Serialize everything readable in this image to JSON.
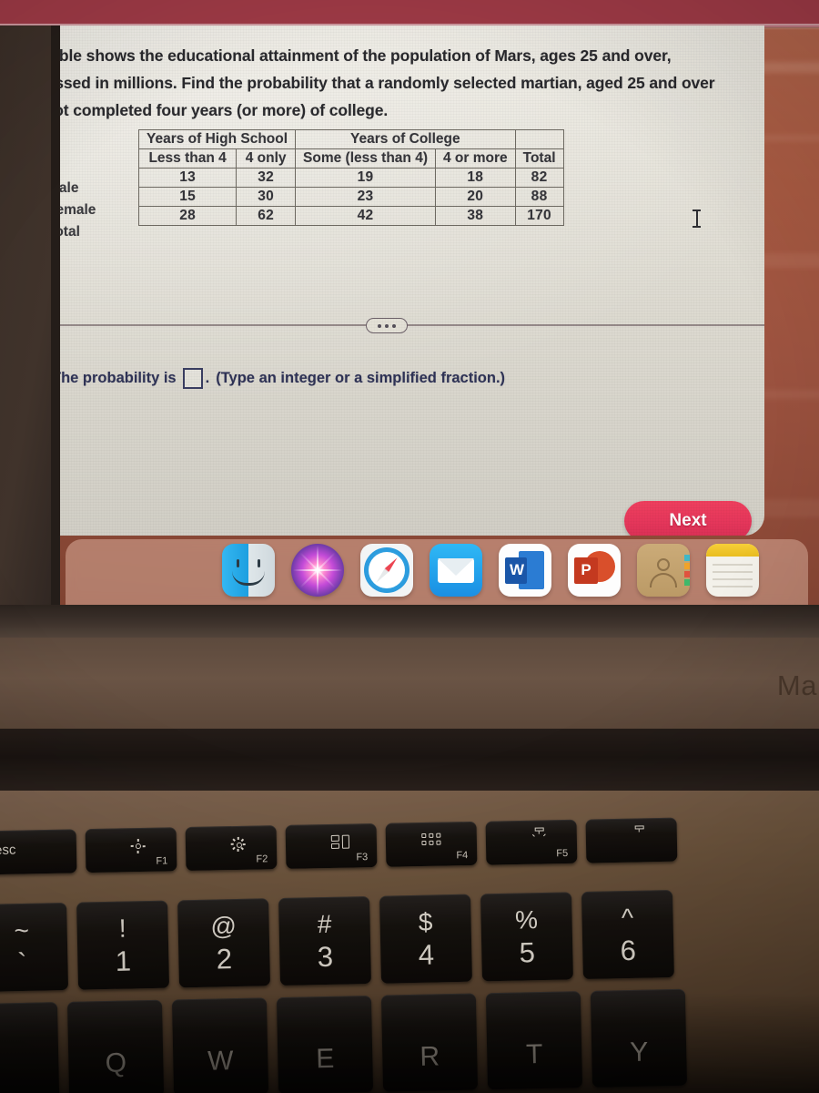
{
  "problem": {
    "lines": [
      "The table shows the educational attainment of the population of Mars, ages 25 and over,",
      "expressed in millions. Find the probability that a randomly selected martian, aged 25 and over",
      "has not completed four years (or more) of college."
    ]
  },
  "table": {
    "group_headers": [
      {
        "label": "Years of High School",
        "colspan": 2
      },
      {
        "label": "Years of College",
        "colspan": 2
      },
      {
        "label": "",
        "colspan": 1
      }
    ],
    "columns": [
      "Less than 4",
      "4 only",
      "Some (less than 4)",
      "4 or more",
      "Total"
    ],
    "rows": [
      {
        "label": "Male",
        "values": [
          "13",
          "32",
          "19",
          "18",
          "82"
        ]
      },
      {
        "label": "Female",
        "values": [
          "15",
          "30",
          "23",
          "20",
          "88"
        ]
      },
      {
        "label": "Total",
        "values": [
          "28",
          "62",
          "42",
          "38",
          "170"
        ]
      }
    ]
  },
  "answer": {
    "prefix": "The probability is",
    "value": "",
    "period": ".",
    "hint": "(Type an integer or a simplified fraction.)"
  },
  "buttons": {
    "next_label": "Next",
    "ellipsis_label": "more-options"
  },
  "dock": {
    "items": [
      {
        "name": "finder",
        "label": "Finder"
      },
      {
        "name": "siri",
        "label": "Siri"
      },
      {
        "name": "safari",
        "label": "Safari"
      },
      {
        "name": "mail",
        "label": "Mail"
      },
      {
        "name": "word",
        "label": "Microsoft Word",
        "glyph": "W"
      },
      {
        "name": "powerpoint",
        "label": "Microsoft PowerPoint",
        "glyph": "P"
      },
      {
        "name": "contacts",
        "label": "Contacts"
      },
      {
        "name": "notes",
        "label": "Notes"
      }
    ]
  },
  "laptop": {
    "brand_text": "Ma",
    "function_row": [
      {
        "key": "esc",
        "label": "esc",
        "icon": ""
      },
      {
        "key": "F1",
        "label": "F1",
        "icon": "brightness-down-icon"
      },
      {
        "key": "F2",
        "label": "F2",
        "icon": "brightness-up-icon"
      },
      {
        "key": "F3",
        "label": "F3",
        "icon": "mission-control-icon"
      },
      {
        "key": "F4",
        "label": "F4",
        "icon": "launchpad-icon"
      },
      {
        "key": "F5",
        "label": "F5",
        "icon": "keyboard-backlight-icon"
      },
      {
        "key": "F6",
        "label": "",
        "icon": "keyboard-backlight-up-icon"
      }
    ],
    "number_row": [
      {
        "upper": "~",
        "lower": "`"
      },
      {
        "upper": "!",
        "lower": "1"
      },
      {
        "upper": "@",
        "lower": "2"
      },
      {
        "upper": "#",
        "lower": "3"
      },
      {
        "upper": "$",
        "lower": "4"
      },
      {
        "upper": "%",
        "lower": "5"
      },
      {
        "upper": "^",
        "lower": "6"
      }
    ],
    "letter_row": [
      "Q",
      "W",
      "E",
      "R",
      "T",
      "Y"
    ]
  },
  "colors": {
    "accent_red": "#e5365b",
    "top_band": "#9e3a46",
    "panel_bg": "#e9e6dc",
    "answer_text": "#2f3356",
    "wallpaper": "#a85a42"
  }
}
